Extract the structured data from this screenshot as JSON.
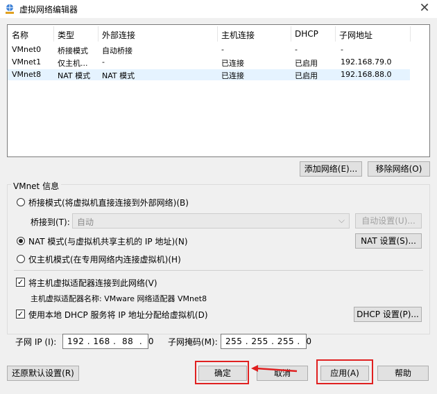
{
  "window": {
    "title": "虚拟网络编辑器",
    "close_glyph": "✕",
    "icon": "network-globe-icon"
  },
  "network_list": {
    "columns": [
      "名称",
      "类型",
      "外部连接",
      "主机连接",
      "DHCP",
      "子网地址"
    ],
    "rows": [
      {
        "name": "VMnet0",
        "type": "桥接模式",
        "external": "自动桥接",
        "host": "-",
        "dhcp": "-",
        "subnet": "-",
        "selected": false
      },
      {
        "name": "VMnet1",
        "type": "仅主机...",
        "external": "-",
        "host": "已连接",
        "dhcp": "已启用",
        "subnet": "192.168.79.0",
        "selected": false
      },
      {
        "name": "VMnet8",
        "type": "NAT 模式",
        "external": "NAT 模式",
        "host": "已连接",
        "dhcp": "已启用",
        "subnet": "192.168.88.0",
        "selected": true
      }
    ]
  },
  "list_buttons": {
    "add": "添加网络(E)...",
    "remove": "移除网络(O)"
  },
  "vmnet_info": {
    "group_label": "VMnet 信息",
    "bridge_radio": "桥接模式(将虚拟机直接连接到外部网络)(B)",
    "bridge_to_label": "桥接到(T):",
    "bridge_to_value": "自动",
    "auto_settings": "自动设置(U)...",
    "nat_radio": "NAT 模式(与虚拟机共享主机的 IP 地址)(N)",
    "nat_settings": "NAT 设置(S)...",
    "hostonly_radio": "仅主机模式(在专用网络内连接虚拟机)(H)",
    "selected_mode": "nat",
    "connect_adapter_check": "将主机虚拟适配器连接到此网络(V)",
    "connect_adapter_checked": true,
    "adapter_name_label": "主机虚拟适配器名称: VMware 网络适配器 VMnet8",
    "dhcp_check": "使用本地 DHCP 服务将 IP 地址分配给虚拟机(D)",
    "dhcp_checked": true,
    "dhcp_settings": "DHCP 设置(P)...",
    "subnet_ip_label": "子网 IP (I):",
    "subnet_ip_value": "192 . 168 .  88  .  0",
    "subnet_mask_label": "子网掩码(M):",
    "subnet_mask_value": "255 . 255 . 255 .  0"
  },
  "footer": {
    "restore": "还原默认设置(R)",
    "ok": "确定",
    "cancel": "取消",
    "apply": "应用(A)",
    "help": "帮助"
  },
  "annotation": {
    "color": "#e02020"
  }
}
